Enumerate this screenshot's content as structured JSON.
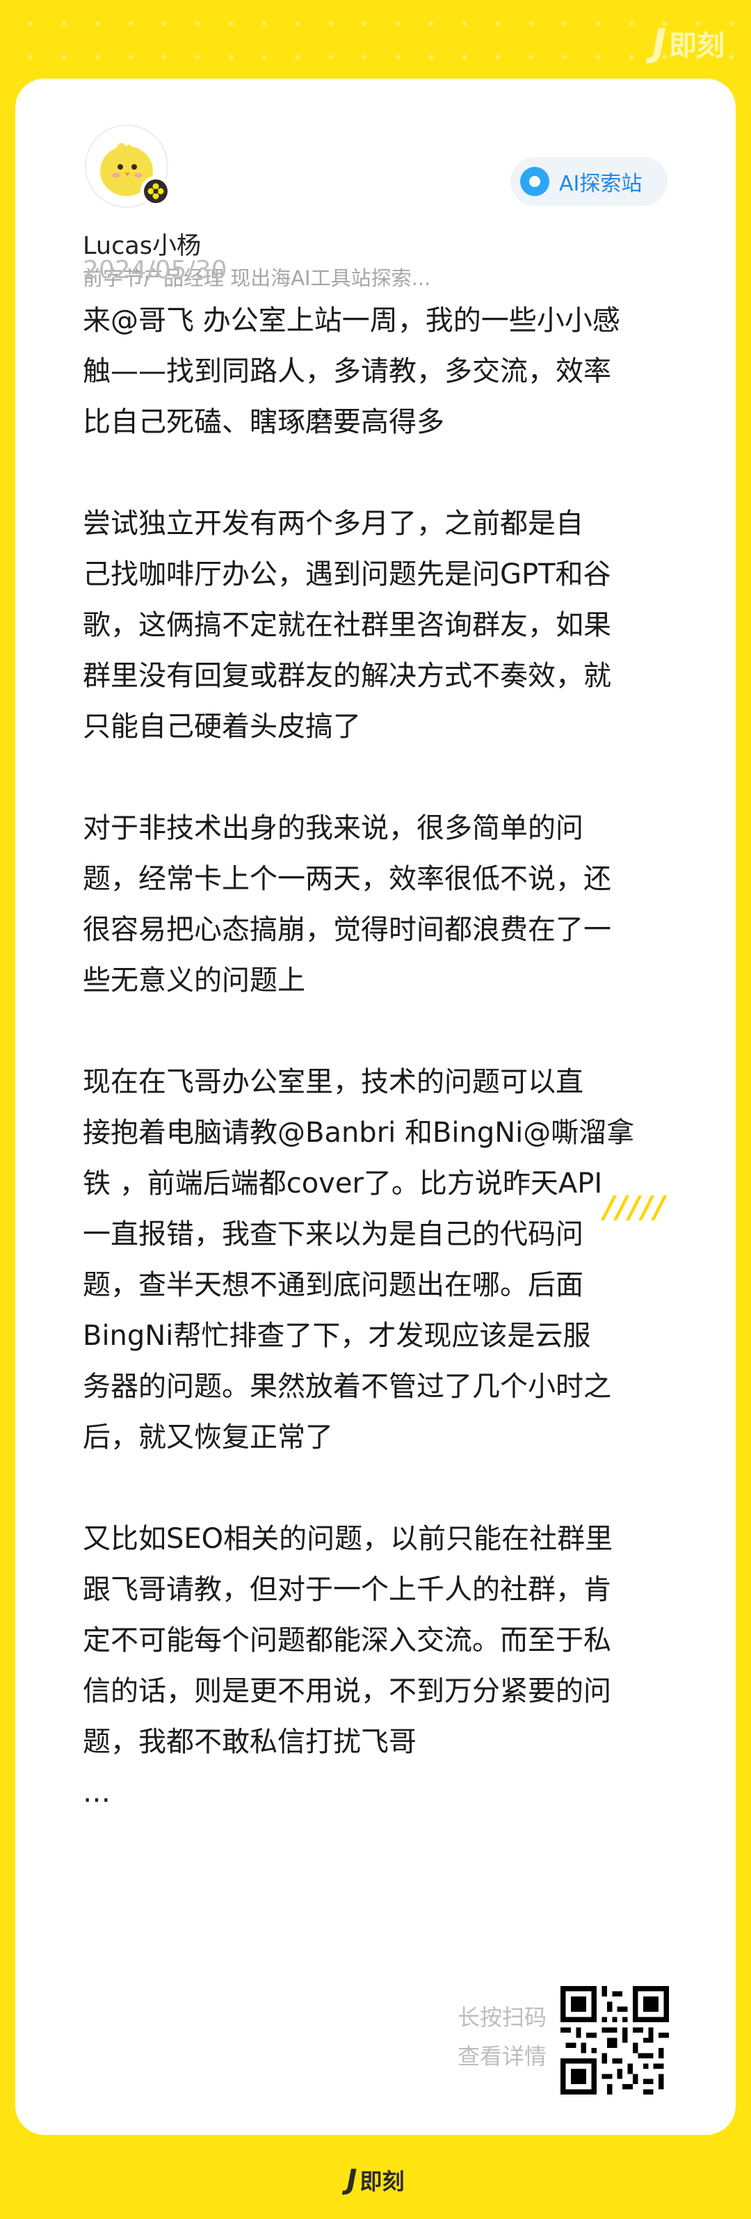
{
  "brand": {
    "logo_mark": "J",
    "logo_text": "即刻"
  },
  "post": {
    "author": {
      "name": "Lucas小杨",
      "bio": "前字节产品经理 现出海AI工具站探索...",
      "avatar_icon": "chick-avatar-icon",
      "badge_icon": "flower-badge-icon"
    },
    "topic": {
      "label": "AI探索站",
      "icon": "topic-dot-icon",
      "color": "#1E88E5"
    },
    "date": "2024/05/30",
    "paragraphs": [
      {
        "lines": [
          "来@哥飞 办公室上站一周，我的一些小小感",
          "触——找到同路人，多请教，多交流，效率",
          "比自己死磕、瞎琢磨要高得多"
        ]
      },
      {
        "lines": [
          "尝试独立开发有两个多月了，之前都是自",
          "己找咖啡厅办公，遇到问题先是问GPT和谷",
          "歌，这俩搞不定就在社群里咨询群友，如果",
          "群里没有回复或群友的解决方式不奏效，就",
          "只能自己硬着头皮搞了"
        ]
      },
      {
        "lines": [
          "对于非技术出身的我来说，很多简单的问",
          "题，经常卡上个一两天，效率很低不说，还",
          "很容易把心态搞崩，觉得时间都浪费在了一",
          "些无意义的问题上"
        ]
      },
      {
        "lines": [
          "现在在飞哥办公室里，技术的问题可以直",
          "接抱着电脑请教@Banbri 和BingNi@嘶溜拿",
          "铁 ，前端后端都cover了。比方说昨天API",
          "一直报错，我查下来以为是自己的代码问",
          "题，查半天想不通到底问题出在哪。后面",
          "BingNi帮忙排查了下，才发现应该是云服",
          "务器的问题。果然放着不管过了几个小时之",
          "后，就又恢复正常了"
        ]
      },
      {
        "lines": [
          "又比如SEO相关的问题，以前只能在社群里",
          "跟飞哥请教，但对于一个上千人的社群，肯",
          "定不可能每个问题都能深入交流。而至于私",
          "信的话，则是更不用说，不到万分紧要的问",
          "题，我都不敢私信打扰飞哥"
        ]
      }
    ],
    "truncation": "…"
  },
  "decoration": {
    "slashes": "/////"
  },
  "footer": {
    "scan_line1": "长按扫码",
    "scan_line2": "查看详情",
    "qr_icon": "qr-code-icon"
  },
  "colors": {
    "background": "#FFE411",
    "card": "#FFFFFF",
    "accent_blue": "#2BA6F7",
    "text": "#1A1A1A",
    "muted": "#A6A6A6"
  }
}
